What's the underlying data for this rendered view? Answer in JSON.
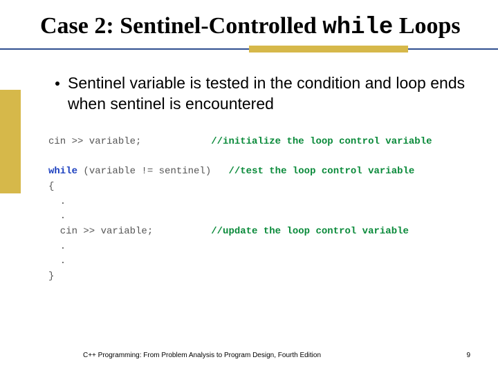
{
  "title": {
    "prefix": "Case 2: Sentinel-Controlled ",
    "mono": "while",
    "suffix": " Loops"
  },
  "bullet": "Sentinel variable is tested in the condition and loop ends when sentinel is encountered",
  "code": {
    "l1a": "cin >> variable;",
    "l1pad": "            ",
    "l1c": "//initialize the loop control variable",
    "blank": " ",
    "l2a": "while",
    "l2b": " (variable != sentinel)",
    "l2pad": "   ",
    "l2c": "//test the loop control variable",
    "l3": "{",
    "l4": "  .",
    "l5": "  .",
    "l6a": "  cin >> variable;",
    "l6pad": "          ",
    "l6c": "//update the loop control variable",
    "l7": "  .",
    "l8": "  .",
    "l9": "}"
  },
  "footer": {
    "text": "C++ Programming: From Problem Analysis to Program Design, Fourth Edition",
    "page": "9"
  }
}
